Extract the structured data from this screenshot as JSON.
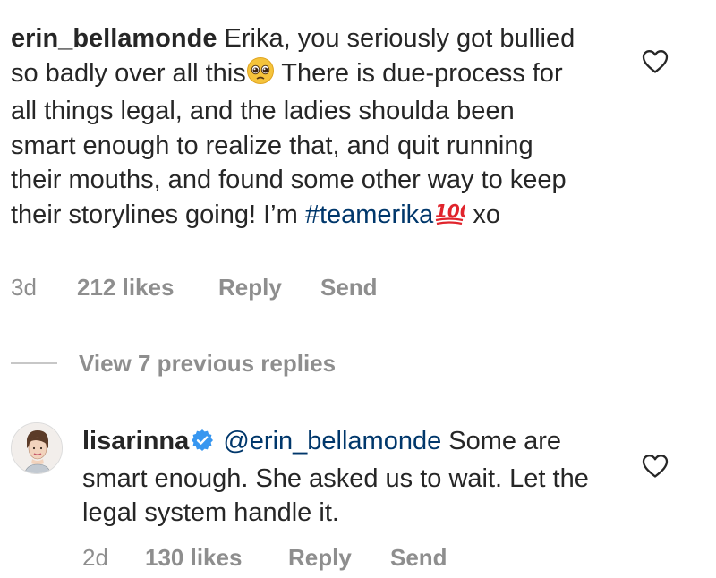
{
  "comment1": {
    "username": "erin_bellamonde",
    "text_part1": "Erika, you seriously got bullied so badly over all this",
    "emoji1": "pleading-face-emoji",
    "text_part2": "There is due-process for all things legal, and the ladies shoulda been smart enough to realize that, and quit running their mouths, and found some other way to keep their storylines going! I’m ",
    "hashtag": "#teamerika",
    "emoji2": "hundred-points-emoji",
    "text_part3": " xo",
    "time": "3d",
    "likes": "212 likes",
    "reply_label": "Reply",
    "send_label": "Send"
  },
  "view_replies": {
    "label": "View 7 previous replies"
  },
  "reply1": {
    "username": "lisarinna",
    "verified": true,
    "mention": "@erin_bellamonde",
    "text": " Some are smart enough. She asked us to wait. Let the legal system handle it.",
    "time": "2d",
    "likes": "130 likes",
    "reply_label": "Reply",
    "send_label": "Send"
  },
  "icons": {
    "like": "heart-outline-icon",
    "verified": "verified-badge-icon"
  },
  "colors": {
    "text": "#262626",
    "secondary": "#8e8e8e",
    "link": "#00376b",
    "verified": "#3897f0"
  }
}
